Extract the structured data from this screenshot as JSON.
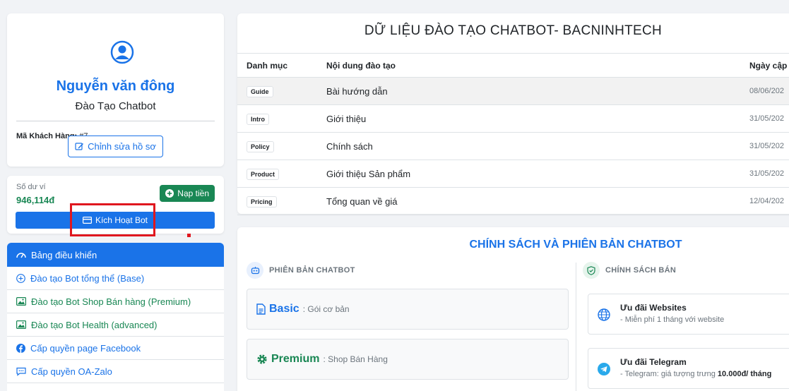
{
  "profile": {
    "name": "Nguyễn văn đông",
    "role": "Đào Tạo Chatbot",
    "customer_id_label": "Mã Khách Hàng:",
    "customer_id": "#7",
    "edit_label": "Chỉnh sửa hồ sơ"
  },
  "wallet": {
    "balance_label": "Số dư ví",
    "balance": "946,114đ",
    "topup_label": "Nạp tiền",
    "activate_label": "Kích Hoạt Bot"
  },
  "sidebar": {
    "items": [
      {
        "label": "Bảng điều khiển",
        "icon": "dashboard-icon"
      },
      {
        "label": "Đào tạo Bot tổng thể (Base)",
        "icon": "plus-circle-icon"
      },
      {
        "label": "Đào tạo Bot Shop Bán hàng (Premium)",
        "icon": "image-icon"
      },
      {
        "label": "Đào tạo Bot Health (advanced)",
        "icon": "image-icon"
      },
      {
        "label": "Cấp quyền page Facebook",
        "icon": "facebook-icon"
      },
      {
        "label": "Cấp quyền OA-Zalo",
        "icon": "chat-icon"
      }
    ]
  },
  "training": {
    "title": "DỮ LIỆU ĐÀO TẠO CHATBOT- BACNINHTECH",
    "columns": [
      "Danh mục",
      "Nội dung đào tạo",
      "Ngày cập"
    ],
    "rows": [
      {
        "tag": "Guide",
        "content": "Bài hướng dẫn",
        "date": "08/06/202"
      },
      {
        "tag": "Intro",
        "content": "Giới thiệu",
        "date": "31/05/202"
      },
      {
        "tag": "Policy",
        "content": "Chính sách",
        "date": "31/05/202"
      },
      {
        "tag": "Product",
        "content": "Giới thiệu Sản phẩm",
        "date": "31/05/202"
      },
      {
        "tag": "Pricing",
        "content": "Tổng quan về giá",
        "date": "12/04/202"
      }
    ]
  },
  "policy": {
    "title": "CHÍNH SÁCH VÀ PHIÊN BẢN CHATBOT",
    "versions_heading": "PHIÊN BẢN CHATBOT",
    "sales_heading": "CHÍNH SÁCH BÁN",
    "versions": [
      {
        "name": "Basic",
        "desc": ": Gói cơ bản",
        "color": "#1a73e8"
      },
      {
        "name": "Premium",
        "desc": ": Shop Bán Hàng",
        "color": "#198754"
      }
    ],
    "offers": [
      {
        "title": "Ưu đãi Websites",
        "desc": "- Miễn phí 1 tháng với website",
        "desc_bold": ""
      },
      {
        "title": "Ưu đãi Telegram",
        "desc": "- Telegram: giá tượng trưng ",
        "desc_bold": "10.000đ/ tháng"
      }
    ]
  },
  "colors": {
    "primary": "#1a73e8",
    "success": "#198754",
    "highlight": "#e0171f"
  }
}
